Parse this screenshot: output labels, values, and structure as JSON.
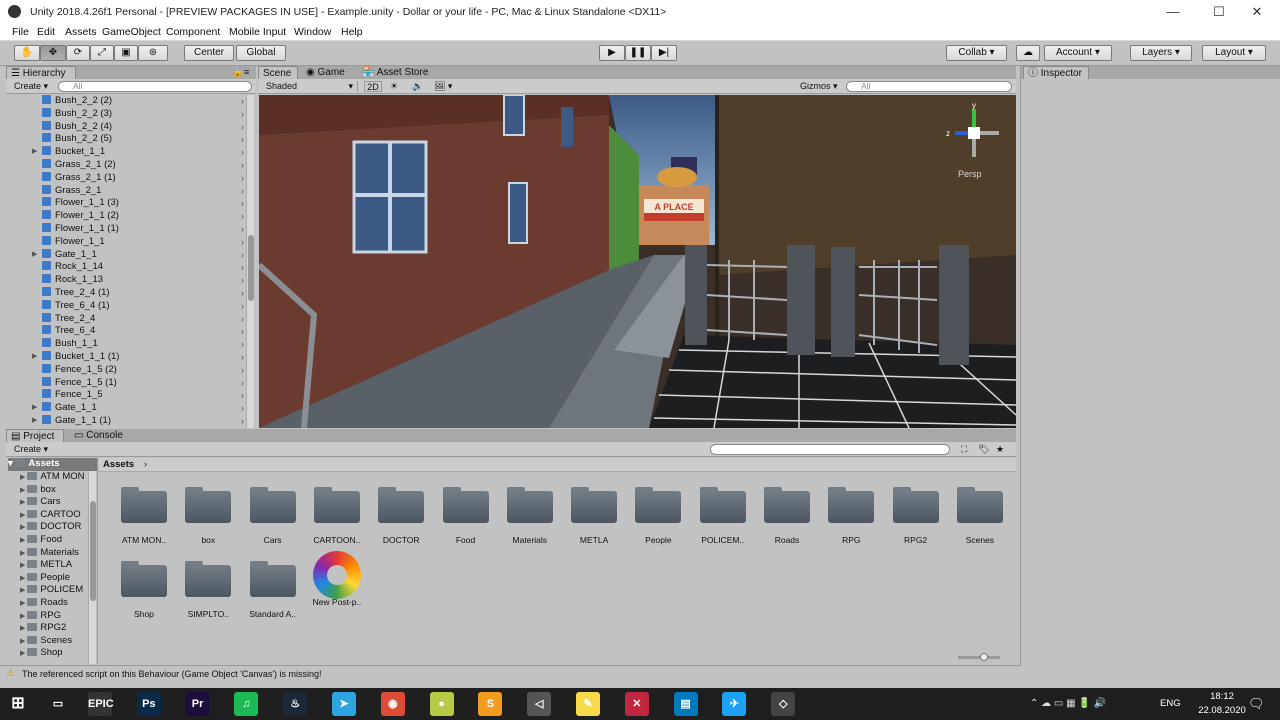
{
  "window": {
    "title": "Unity 2018.4.26f1 Personal - [PREVIEW PACKAGES IN USE] - Example.unity - Dollar or your life - PC, Mac & Linux Standalone <DX11>"
  },
  "menu": [
    "File",
    "Edit",
    "Assets",
    "GameObject",
    "Component",
    "Mobile Input",
    "Window",
    "Help"
  ],
  "toolbar": {
    "center_label": "Center",
    "global_label": "Global",
    "collab_label": "Collab ▾",
    "account_label": "Account",
    "layers_label": "Layers",
    "layout_label": "Layout"
  },
  "hierarchy": {
    "tab": "Hierarchy",
    "create": "Create ▾",
    "search_placeholder": "All",
    "items": [
      {
        "label": "Bush_2_2 (2)",
        "fold": false
      },
      {
        "label": "Bush_2_2 (3)",
        "fold": false
      },
      {
        "label": "Bush_2_2 (4)",
        "fold": false
      },
      {
        "label": "Bush_2_2 (5)",
        "fold": false
      },
      {
        "label": "Bucket_1_1",
        "fold": true
      },
      {
        "label": "Grass_2_1 (2)",
        "fold": false
      },
      {
        "label": "Grass_2_1 (1)",
        "fold": false
      },
      {
        "label": "Grass_2_1",
        "fold": false
      },
      {
        "label": "Flower_1_1 (3)",
        "fold": false
      },
      {
        "label": "Flower_1_1 (2)",
        "fold": false
      },
      {
        "label": "Flower_1_1 (1)",
        "fold": false
      },
      {
        "label": "Flower_1_1",
        "fold": false
      },
      {
        "label": "Gate_1_1",
        "fold": true
      },
      {
        "label": "Rock_1_14",
        "fold": false
      },
      {
        "label": "Rock_1_13",
        "fold": false
      },
      {
        "label": "Tree_2_4 (1)",
        "fold": false
      },
      {
        "label": "Tree_6_4 (1)",
        "fold": false
      },
      {
        "label": "Tree_2_4",
        "fold": false
      },
      {
        "label": "Tree_6_4",
        "fold": false
      },
      {
        "label": "Bush_1_1",
        "fold": false
      },
      {
        "label": "Bucket_1_1 (1)",
        "fold": true
      },
      {
        "label": "Fence_1_5 (2)",
        "fold": false
      },
      {
        "label": "Fence_1_5 (1)",
        "fold": false
      },
      {
        "label": "Fence_1_5",
        "fold": false
      },
      {
        "label": "Gate_1_1",
        "fold": true
      },
      {
        "label": "Gate_1_1 (1)",
        "fold": true
      }
    ]
  },
  "scene": {
    "tabs": [
      "Scene",
      "Game",
      "Asset Store"
    ],
    "shading": "Shaded",
    "mode_2d": "2D",
    "gizmos": "Gizmos ▾",
    "search_placeholder": "All",
    "persp": "Persp",
    "sign": "A PLACE"
  },
  "inspector": {
    "tab": "Inspector"
  },
  "project": {
    "tabs": [
      "Project",
      "Console"
    ],
    "create": "Create ▾",
    "root": "Assets",
    "breadcrumb": "Assets",
    "tree": [
      "ATM MON",
      "box",
      "Cars",
      "CARTOO",
      "DOCTOR",
      "Food",
      "Materials",
      "METLA",
      "People",
      "POLICEM",
      "Roads",
      "RPG",
      "RPG2",
      "Scenes",
      "Shop"
    ],
    "grid": [
      {
        "label": "ATM MON..",
        "type": "folder"
      },
      {
        "label": "box",
        "type": "folder"
      },
      {
        "label": "Cars",
        "type": "folder"
      },
      {
        "label": "CARTOON..",
        "type": "folder"
      },
      {
        "label": "DOCTOR",
        "type": "folder"
      },
      {
        "label": "Food",
        "type": "folder"
      },
      {
        "label": "Materials",
        "type": "folder"
      },
      {
        "label": "METLA",
        "type": "folder"
      },
      {
        "label": "People",
        "type": "folder"
      },
      {
        "label": "POLICEM..",
        "type": "folder"
      },
      {
        "label": "Roads",
        "type": "folder"
      },
      {
        "label": "RPG",
        "type": "folder"
      },
      {
        "label": "RPG2",
        "type": "folder"
      },
      {
        "label": "Scenes",
        "type": "folder"
      },
      {
        "label": "Shop",
        "type": "folder"
      },
      {
        "label": "SIMPLTO..",
        "type": "folder"
      },
      {
        "label": "Standard A..",
        "type": "folder"
      },
      {
        "label": "New Post-p..",
        "type": "asset"
      }
    ]
  },
  "status": {
    "message": "The referenced script on this Behaviour (Game Object 'Canvas') is missing!"
  },
  "taskbar": {
    "apps": [
      {
        "name": "epic-games",
        "label": "EPIC",
        "color": "#333333"
      },
      {
        "name": "photoshop",
        "label": "Ps",
        "color": "#0b2a4a"
      },
      {
        "name": "premiere",
        "label": "Pr",
        "color": "#1b0e3d"
      },
      {
        "name": "spotify",
        "label": "♫",
        "color": "#1db954"
      },
      {
        "name": "steam",
        "label": "♨",
        "color": "#1b2838"
      },
      {
        "name": "telegram",
        "label": "➤",
        "color": "#2ca5e0"
      },
      {
        "name": "chrome",
        "label": "◉",
        "color": "#dd4b39"
      },
      {
        "name": "tennis",
        "label": "●",
        "color": "#b7c947"
      },
      {
        "name": "sublime",
        "label": "S",
        "color": "#f29c1f"
      },
      {
        "name": "unity-hub",
        "label": "◁",
        "color": "#555555"
      },
      {
        "name": "notes",
        "label": "✎",
        "color": "#f7d94c"
      },
      {
        "name": "app-x",
        "label": "✕",
        "color": "#c0283f"
      },
      {
        "name": "trello",
        "label": "▤",
        "color": "#0079bf"
      },
      {
        "name": "twitter",
        "label": "✈",
        "color": "#1da1f2"
      },
      {
        "name": "unity",
        "label": "◇",
        "color": "#444444"
      }
    ],
    "lang": "ENG",
    "time": "18:12",
    "date": "22.08.2020"
  }
}
